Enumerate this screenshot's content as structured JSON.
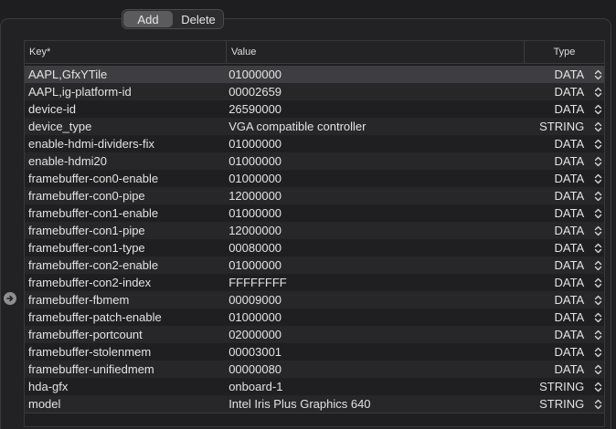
{
  "toolbar": {
    "add_label": "Add",
    "delete_label": "Delete"
  },
  "table": {
    "columns": {
      "key": "Key*",
      "value": "Value",
      "type": "Type"
    },
    "rows": [
      {
        "key": "AAPL,GfxYTile",
        "value": "01000000",
        "type": "DATA"
      },
      {
        "key": "AAPL,ig-platform-id",
        "value": "00002659",
        "type": "DATA"
      },
      {
        "key": "device-id",
        "value": "26590000",
        "type": "DATA"
      },
      {
        "key": "device_type",
        "value": "VGA compatible controller",
        "type": "STRING"
      },
      {
        "key": "enable-hdmi-dividers-fix",
        "value": "01000000",
        "type": "DATA"
      },
      {
        "key": "enable-hdmi20",
        "value": "01000000",
        "type": "DATA"
      },
      {
        "key": "framebuffer-con0-enable",
        "value": "01000000",
        "type": "DATA"
      },
      {
        "key": "framebuffer-con0-pipe",
        "value": "12000000",
        "type": "DATA"
      },
      {
        "key": "framebuffer-con1-enable",
        "value": "01000000",
        "type": "DATA"
      },
      {
        "key": "framebuffer-con1-pipe",
        "value": "12000000",
        "type": "DATA"
      },
      {
        "key": "framebuffer-con1-type",
        "value": "00080000",
        "type": "DATA"
      },
      {
        "key": "framebuffer-con2-enable",
        "value": "01000000",
        "type": "DATA"
      },
      {
        "key": "framebuffer-con2-index",
        "value": "FFFFFFFF",
        "type": "DATA"
      },
      {
        "key": "framebuffer-fbmem",
        "value": "00009000",
        "type": "DATA"
      },
      {
        "key": "framebuffer-patch-enable",
        "value": "01000000",
        "type": "DATA"
      },
      {
        "key": "framebuffer-portcount",
        "value": "02000000",
        "type": "DATA"
      },
      {
        "key": "framebuffer-stolenmem",
        "value": "00003001",
        "type": "DATA"
      },
      {
        "key": "framebuffer-unifiedmem",
        "value": "00000080",
        "type": "DATA"
      },
      {
        "key": "hda-gfx",
        "value": "onboard-1",
        "type": "STRING"
      },
      {
        "key": "model",
        "value": "Intel Iris Plus Graphics 640",
        "type": "STRING"
      }
    ]
  },
  "icons": {
    "stepper": "up-down-chevron-icon",
    "disclosure": "arrow-right-circle-icon"
  },
  "colors": {
    "background": "#1e1e20",
    "selected_row": "#3e3e42",
    "alt_row": "#27272a"
  }
}
